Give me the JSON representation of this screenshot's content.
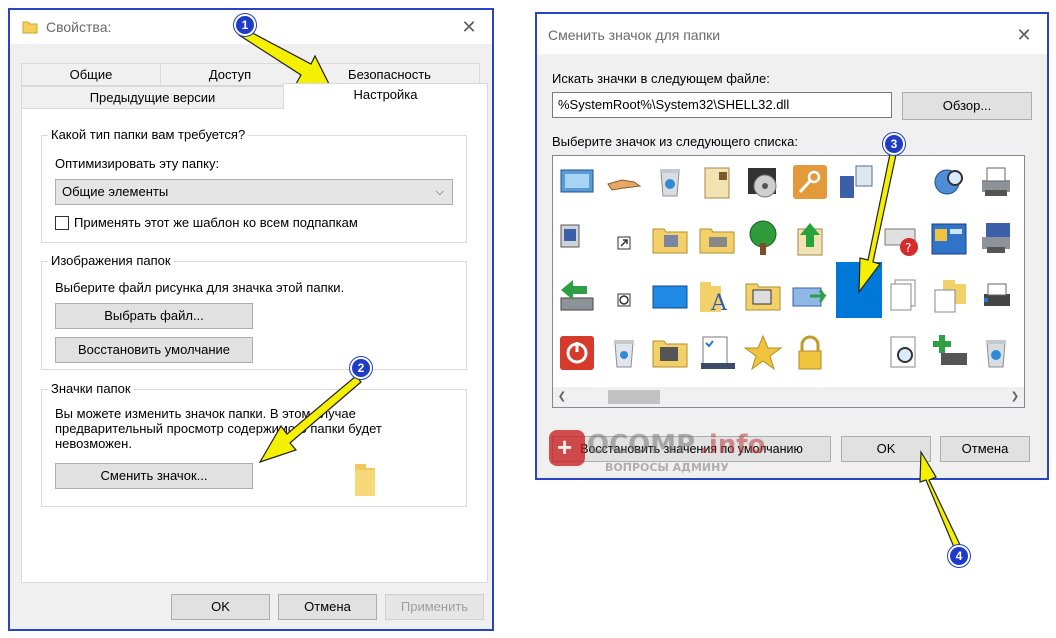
{
  "left_dialog": {
    "title": "Свойства:",
    "tabs_row1": [
      "Общие",
      "Доступ",
      "Безопасность"
    ],
    "tabs_row2": [
      "Предыдущие версии",
      "Настройка"
    ],
    "group1": {
      "title": "Какой тип папки вам требуется?",
      "optimize_label": "Оптимизировать эту папку:",
      "select_value": "Общие элементы",
      "checkbox_label": "Применять этот же шаблон ко всем подпапкам"
    },
    "group2": {
      "title": "Изображения папок",
      "description": "Выберите файл рисунка для значка этой папки.",
      "choose_file_button": "Выбрать файл...",
      "restore_default_button": "Восстановить умолчание"
    },
    "group3": {
      "title": "Значки папок",
      "description_lines": [
        "Вы можете изменить значок папки. В этом случае",
        "предварительный просмотр содержимого папки будет",
        "невозможен."
      ],
      "change_icon_button": "Сменить значок..."
    },
    "ok_button": "OK",
    "cancel_button": "Отмена",
    "apply_button": "Применить"
  },
  "right_dialog": {
    "title": "Сменить значок для папки",
    "search_label": "Искать значки в следующем файле:",
    "file_path": "%SystemRoot%\\System32\\SHELL32.dll",
    "browse_button": "Обзор...",
    "list_label": "Выберите значок из следующего списка:",
    "icons": [
      "monitor-window-icon",
      "hand-share-icon",
      "recycle-bin-full-icon",
      "document-grid-icon",
      "media-disc-icon",
      "key-icon",
      "network-computer-icon",
      "blank-icon",
      "globe-search-icon",
      "printer-icon",
      "window-settings-icon",
      "shortcut-arrow-icon",
      "folder-network-icon",
      "folder-printer-icon",
      "tree-icon",
      "upload-arrow-icon",
      "blank-icon",
      "keyboard-help-icon",
      "control-panel-icon",
      "printer-network-icon",
      "drive-back-icon",
      "power-button-icon",
      "blue-screen-icon",
      "folder-fonts-icon",
      "folder-computer-icon",
      "network-sync-icon",
      "blue-square-icon",
      "documents-stack-icon",
      "folder-document-icon",
      "printer-small-icon",
      "power-red-icon",
      "recycle-bin-empty-icon",
      "folder-tools-icon",
      "checklist-icon",
      "star-icon",
      "padlock-icon",
      "blank-icon",
      "magnifier-document-icon",
      "printer-add-icon",
      "recycle-bin-icon"
    ],
    "selected_icon_index": 26,
    "restore_defaults_button": "Восстановить значения по умолчанию",
    "ok_button": "OK",
    "cancel_button": "Отмена"
  },
  "annotations": [
    "1",
    "2",
    "3",
    "4"
  ],
  "watermark": {
    "brand_ocomp": "OCOMP",
    "brand_info": ".info",
    "tagline": "ВОПРОСЫ АДМИНУ"
  },
  "colors": {
    "window_border": "#2845c8",
    "arrow_fill": "#f5f000",
    "badge": "#1e3cc8",
    "selection": "#0078d7"
  }
}
